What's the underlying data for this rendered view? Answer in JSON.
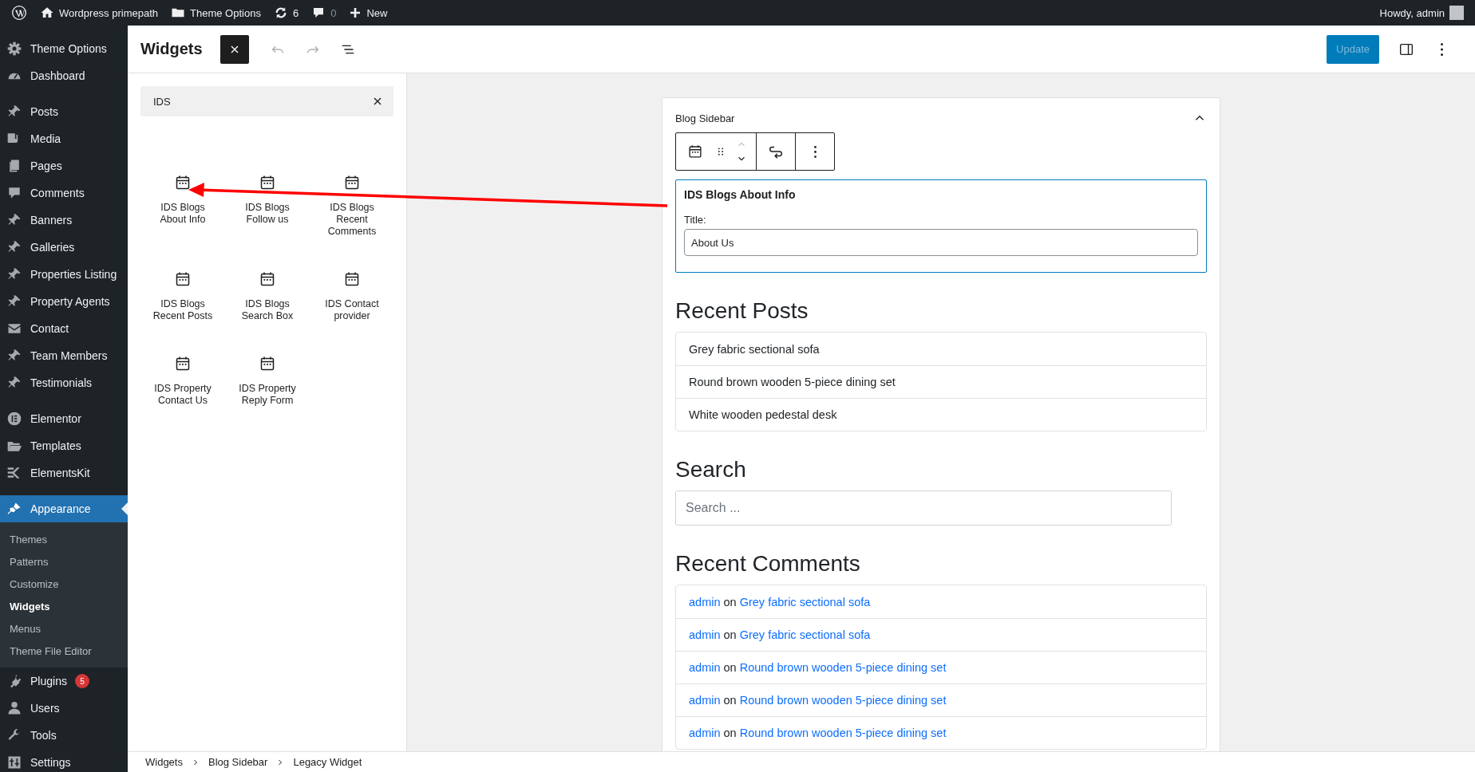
{
  "admin_bar": {
    "site_name": "Wordpress primepath",
    "theme_options": "Theme Options",
    "updates_count": "6",
    "comments_count": "0",
    "new_label": "New",
    "greeting": "Howdy, admin"
  },
  "menu_groups": [
    [
      {
        "label": "Theme Options",
        "selected": false
      },
      {
        "label": "Dashboard",
        "selected": false
      }
    ],
    [
      {
        "label": "Posts",
        "selected": false
      },
      {
        "label": "Media",
        "selected": false
      },
      {
        "label": "Pages",
        "selected": false
      },
      {
        "label": "Comments",
        "selected": false
      },
      {
        "label": "Banners",
        "selected": false
      },
      {
        "label": "Galleries",
        "selected": false
      },
      {
        "label": "Properties Listing",
        "selected": false
      },
      {
        "label": "Property Agents",
        "selected": false
      },
      {
        "label": "Contact",
        "selected": false
      },
      {
        "label": "Team Members",
        "selected": false
      },
      {
        "label": "Testimonials",
        "selected": false
      }
    ],
    [
      {
        "label": "Elementor",
        "selected": false
      },
      {
        "label": "Templates",
        "selected": false
      },
      {
        "label": "ElementsKit",
        "selected": false
      }
    ],
    [
      {
        "label": "Appearance",
        "selected": true,
        "children": [
          {
            "label": "Themes",
            "selected": false
          },
          {
            "label": "Patterns",
            "selected": false
          },
          {
            "label": "Customize",
            "selected": false
          },
          {
            "label": "Widgets",
            "selected": true
          },
          {
            "label": "Menus",
            "selected": false
          },
          {
            "label": "Theme File Editor",
            "selected": false
          }
        ]
      },
      {
        "label": "Plugins",
        "selected": false,
        "badge": "5"
      },
      {
        "label": "Users",
        "selected": false
      },
      {
        "label": "Tools",
        "selected": false
      },
      {
        "label": "Settings",
        "selected": false
      }
    ]
  ],
  "header": {
    "title": "Widgets",
    "update_button": {
      "label": "Update",
      "disabled": true
    }
  },
  "inserter": {
    "search_value": "IDS",
    "blocks": [
      "IDS Blogs About Info",
      "IDS Blogs Follow us",
      "IDS Blogs Recent Comments",
      "IDS Blogs Recent Posts",
      "IDS Blogs Search Box",
      "IDS Contact provider",
      "IDS Property Contact Us",
      "IDS Property Reply Form"
    ]
  },
  "widget_area": {
    "title": "Blog Sidebar",
    "expanded": true,
    "selected_block": {
      "title": "IDS Blogs About Info",
      "field_label": "Title:",
      "field_value": "About Us"
    },
    "recent_posts": {
      "heading": "Recent Posts",
      "items": [
        "Grey fabric sectional sofa",
        "Round brown wooden 5-piece dining set",
        "White wooden pedestal desk"
      ]
    },
    "search": {
      "heading": "Search",
      "placeholder": "Search ..."
    },
    "recent_comments": {
      "heading": "Recent Comments",
      "items": [
        {
          "author": "admin",
          "joiner": "on",
          "post": "Grey fabric sectional sofa"
        },
        {
          "author": "admin",
          "joiner": "on",
          "post": "Grey fabric sectional sofa"
        },
        {
          "author": "admin",
          "joiner": "on",
          "post": "Round brown wooden 5-piece dining set"
        },
        {
          "author": "admin",
          "joiner": "on",
          "post": "Round brown wooden 5-piece dining set"
        },
        {
          "author": "admin",
          "joiner": "on",
          "post": "Round brown wooden 5-piece dining set"
        }
      ]
    }
  },
  "breadcrumb": [
    "Widgets",
    "Blog Sidebar",
    "Legacy Widget"
  ]
}
